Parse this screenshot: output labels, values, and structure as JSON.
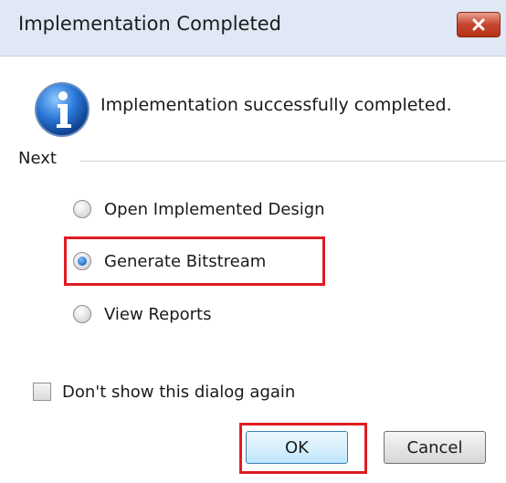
{
  "dialog": {
    "title": "Implementation Completed",
    "message": "Implementation successfully completed.",
    "section_label": "Next",
    "options": [
      {
        "label": "Open Implemented Design",
        "selected": false
      },
      {
        "label": "Generate Bitstream",
        "selected": true
      },
      {
        "label": "View Reports",
        "selected": false
      }
    ],
    "dont_show_again": {
      "label": "Don't show this dialog again",
      "checked": false
    },
    "buttons": {
      "ok": "OK",
      "cancel": "Cancel"
    },
    "highlight_color": "#e01b24"
  }
}
